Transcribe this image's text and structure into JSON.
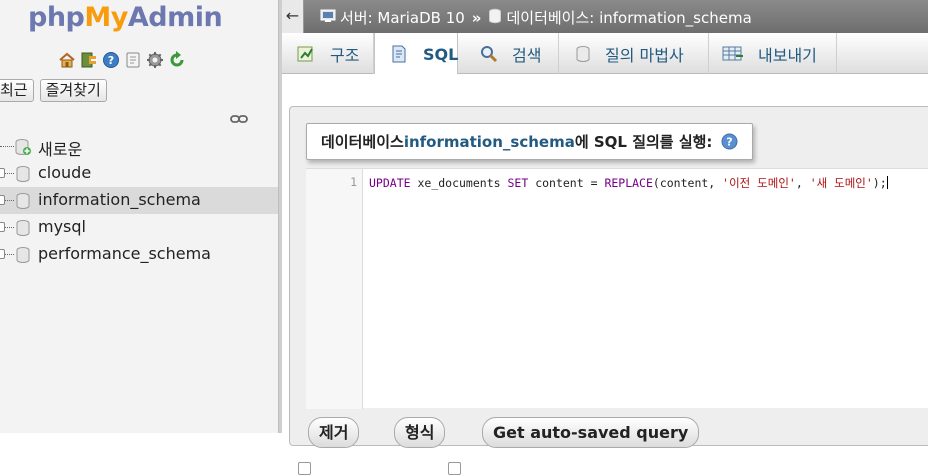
{
  "logo": {
    "part1": "php",
    "part2": "My",
    "part3": "Admin"
  },
  "nav_icons": [
    "home-icon",
    "logout-icon",
    "help-icon",
    "documentation-icon",
    "settings-icon",
    "reload-icon"
  ],
  "nav_tabs": [
    "최근",
    "즐겨찾기"
  ],
  "link_icon": "link-icon",
  "databases": [
    {
      "name": "새로운",
      "selected": false
    },
    {
      "name": "cloude",
      "selected": false
    },
    {
      "name": "information_schema",
      "selected": true
    },
    {
      "name": "mysql",
      "selected": false
    },
    {
      "name": "performance_schema",
      "selected": false
    }
  ],
  "breadcrumb": {
    "back_arrow": "←",
    "server_label": "서버: MariaDB 10",
    "separator": "»",
    "database_label": "데이터베이스: information_schema"
  },
  "tabs": [
    {
      "label": "구조",
      "icon": "structure-icon",
      "active": false
    },
    {
      "label": "SQL",
      "icon": "sql-icon",
      "active": true
    },
    {
      "label": "검색",
      "icon": "search-icon",
      "active": false
    },
    {
      "label": "질의 마법사",
      "icon": "query-wizard-icon",
      "active": false
    },
    {
      "label": "내보내기",
      "icon": "export-icon",
      "active": false
    }
  ],
  "sql_panel": {
    "legend_prefix": "데이터베이스 ",
    "legend_db": "information_schema",
    "legend_suffix": "에 SQL 질의를 실행:",
    "line_number": "1",
    "code_tokens": [
      {
        "t": "UPDATE",
        "c": "kw"
      },
      {
        "t": " xe_documents ",
        "c": ""
      },
      {
        "t": "SET",
        "c": "kw"
      },
      {
        "t": " content = ",
        "c": ""
      },
      {
        "t": "REPLACE",
        "c": "fn"
      },
      {
        "t": "(content, ",
        "c": ""
      },
      {
        "t": "'이전 도메인'",
        "c": "str"
      },
      {
        "t": ", ",
        "c": ""
      },
      {
        "t": "'새 도메인'",
        "c": "str"
      },
      {
        "t": ");",
        "c": ""
      }
    ]
  },
  "buttons": {
    "clear": "제거",
    "format": "형식",
    "autosaved": "Get auto-saved query"
  },
  "colors": {
    "link": "#235a81",
    "keyword": "#770088",
    "string": "#aa1111",
    "logo_blue": "#6c78af",
    "logo_orange": "#f89c0e"
  }
}
